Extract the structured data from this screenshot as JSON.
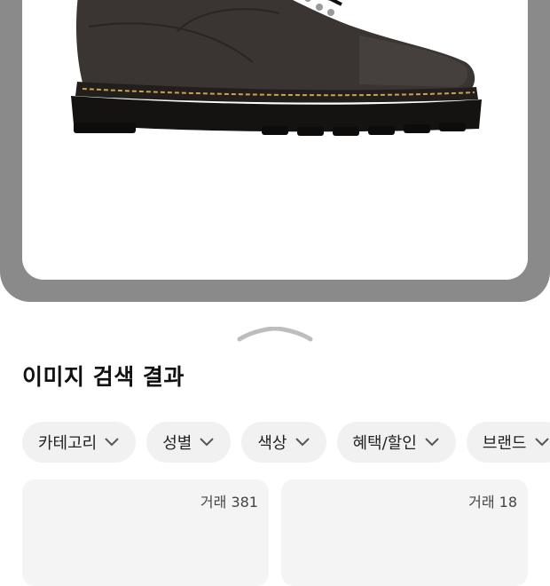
{
  "preview": {
    "image": "shoe-photo",
    "color": "#8a8a8a"
  },
  "section_title": "이미지 검색 결과",
  "filters": [
    {
      "label": "카테고리",
      "icon": "chevron-down-icon"
    },
    {
      "label": "성별",
      "icon": "chevron-down-icon"
    },
    {
      "label": "색상",
      "icon": "chevron-down-icon"
    },
    {
      "label": "혜택/할인",
      "icon": "chevron-down-icon"
    },
    {
      "label": "브랜드",
      "icon": "chevron-down-icon"
    }
  ],
  "results": [
    {
      "trade_label": "거래 381"
    },
    {
      "trade_label": "거래 18"
    }
  ]
}
